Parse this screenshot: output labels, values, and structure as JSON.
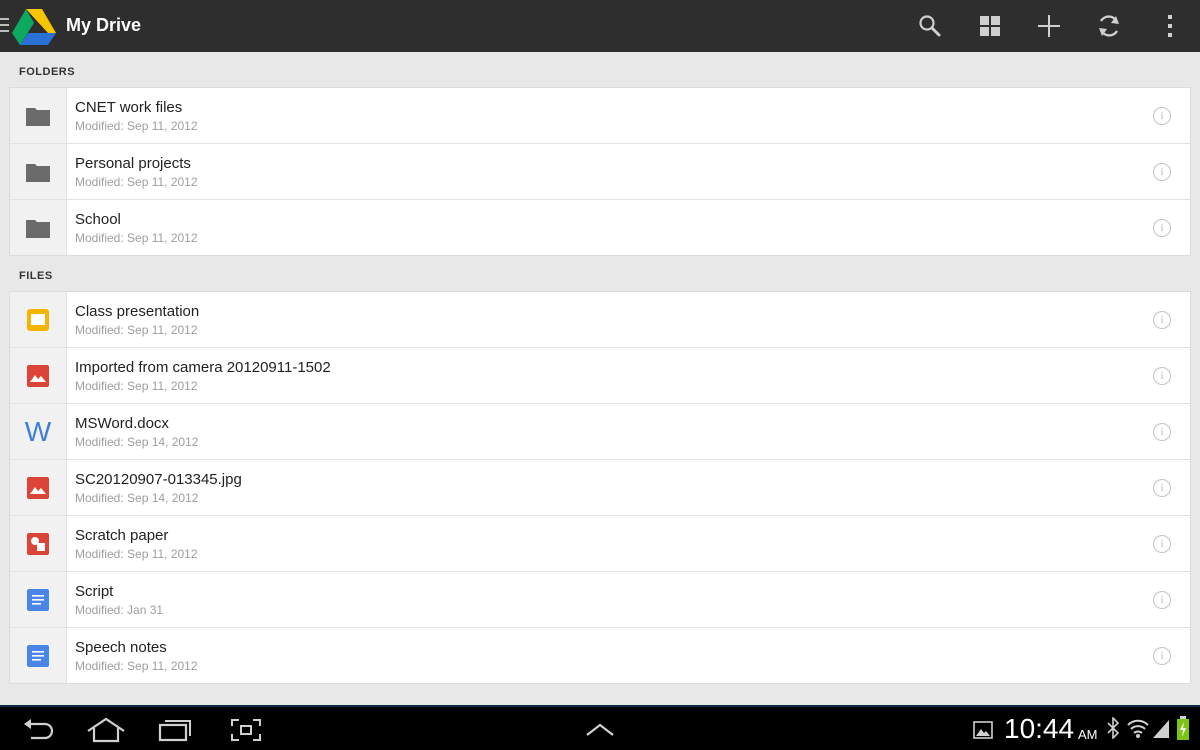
{
  "app": {
    "title": "My Drive"
  },
  "toolbar": {
    "icons": [
      "search-icon",
      "grid-view-icon",
      "add-icon",
      "refresh-icon",
      "overflow-menu-icon"
    ]
  },
  "folders_header": "FOLDERS",
  "folders": [
    {
      "name": "CNET work files",
      "modified": "Modified: Sep 11, 2012",
      "icon": "folder-icon"
    },
    {
      "name": "Personal projects",
      "modified": "Modified: Sep 11, 2012",
      "icon": "folder-icon"
    },
    {
      "name": "School",
      "modified": "Modified: Sep 11, 2012",
      "icon": "folder-icon"
    }
  ],
  "files_header": "FILES",
  "files": [
    {
      "name": "Class presentation",
      "modified": "Modified: Sep 11, 2012",
      "icon": "presentation-icon"
    },
    {
      "name": "Imported from camera 20120911-1502",
      "modified": "Modified: Sep 11, 2012",
      "icon": "image-icon"
    },
    {
      "name": "MSWord.docx",
      "modified": "Modified: Sep 14, 2012",
      "icon": "word-icon"
    },
    {
      "name": "SC20120907-013345.jpg",
      "modified": "Modified: Sep 14, 2012",
      "icon": "image-icon"
    },
    {
      "name": "Scratch paper",
      "modified": "Modified: Sep 11, 2012",
      "icon": "drawing-icon"
    },
    {
      "name": "Script",
      "modified": "Modified: Jan 31",
      "icon": "document-icon"
    },
    {
      "name": "Speech notes",
      "modified": "Modified: Sep 11, 2012",
      "icon": "document-icon"
    }
  ],
  "info_glyph": "i",
  "word_glyph": "W",
  "statusbar": {
    "time": "10:44",
    "ampm": "AM"
  },
  "colors": {
    "actionbar": "#2e2e2e",
    "folder": "#6b6b6b",
    "presentation": "#f4b400",
    "image": "#db4437",
    "word": "#3d7fd6",
    "document": "#4a86e8"
  }
}
